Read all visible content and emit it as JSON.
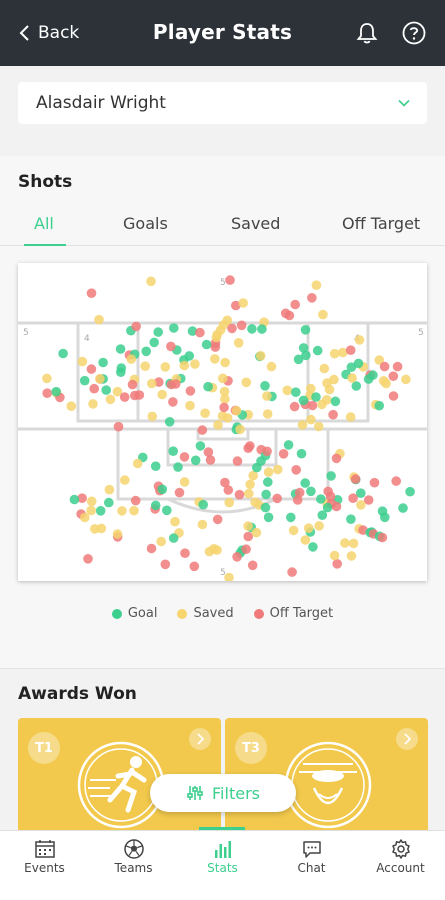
{
  "header": {
    "back_label": "Back",
    "title": "Player Stats"
  },
  "player_select": {
    "value": "Alasdair Wright"
  },
  "shots": {
    "title": "Shots",
    "tabs": [
      "All",
      "Goals",
      "Saved",
      "Off Target"
    ],
    "active_tab": "All",
    "pitch_marks": {
      "top": "5",
      "left": "5",
      "right": "5",
      "inner_left": "4",
      "inner_right": "4",
      "bottom": "5"
    }
  },
  "colors": {
    "accent": "#3ccf8e",
    "goal": "#3ccf8e",
    "saved": "#f6d46e",
    "off_target": "#f07a7a",
    "header": "#2d3239",
    "award": "#f2c94c"
  },
  "legend": [
    {
      "label": "Goal",
      "color": "#3ccf8e"
    },
    {
      "label": "Saved",
      "color": "#f6d46e"
    },
    {
      "label": "Off Target",
      "color": "#f07a7a"
    }
  ],
  "awards": {
    "title": "Awards Won",
    "cards": [
      {
        "badge": "T1",
        "emblem": "runner-emblem"
      },
      {
        "badge": "T3",
        "emblem": "goalkeeper-emblem"
      }
    ]
  },
  "filters_button": {
    "label": "Filters"
  },
  "nav": {
    "items": [
      {
        "label": "Events",
        "icon": "calendar-icon"
      },
      {
        "label": "Teams",
        "icon": "ball-icon"
      },
      {
        "label": "Stats",
        "icon": "bar-chart-icon"
      },
      {
        "label": "Chat",
        "icon": "chat-icon"
      },
      {
        "label": "Account",
        "icon": "gear-icon"
      }
    ],
    "active": "Stats"
  }
}
